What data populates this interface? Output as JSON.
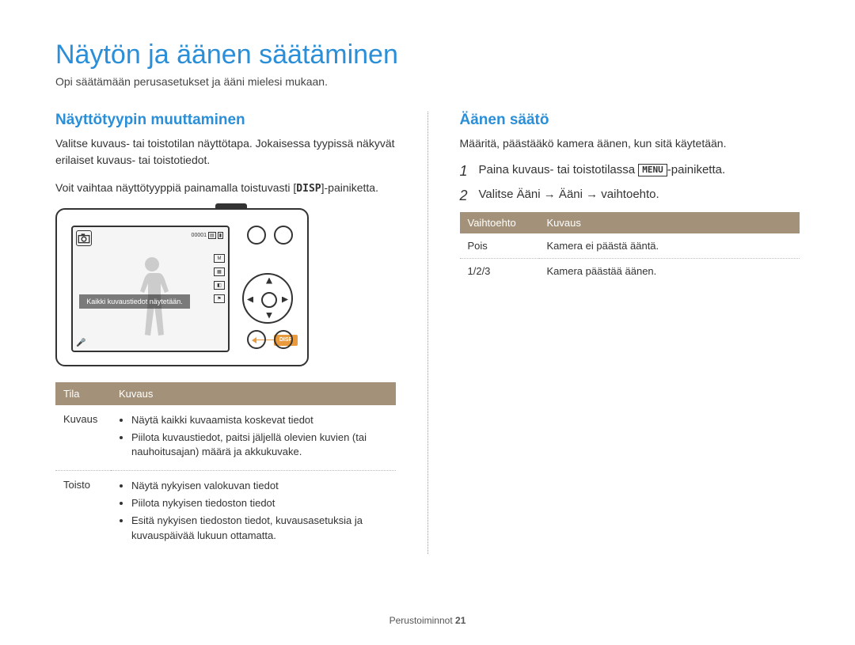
{
  "title": "Näytön ja äänen säätäminen",
  "subtitle": "Opi säätämään perusasetukset ja ääni mielesi mukaan.",
  "left": {
    "section_title": "Näyttötyypin muuttaminen",
    "p1": "Valitse kuvaus- tai toistotilan näyttötapa. Jokaisessa tyypissä näkyvät erilaiset kuvaus- tai toistotiedot.",
    "p2_prefix": "Voit vaihtaa näyttötyyppiä painamalla toistuvasti [",
    "p2_disp": "DISP",
    "p2_suffix": "]-painiketta.",
    "lcd_caption": "Kaikki kuvaustiedot näytetään.",
    "lcd_counter": "00001",
    "disp_indicator": "DISP",
    "table": {
      "headers": [
        "Tila",
        "Kuvaus"
      ],
      "rows": [
        {
          "mode": "Kuvaus",
          "items": [
            "Näytä kaikki kuvaamista koskevat tiedot",
            "Piilota kuvaustiedot, paitsi jäljellä olevien kuvien (tai nauhoitusajan) määrä ja akkukuvake."
          ]
        },
        {
          "mode": "Toisto",
          "items": [
            "Näytä nykyisen valokuvan tiedot",
            "Piilota nykyisen tiedoston tiedot",
            "Esitä nykyisen tiedoston tiedot, kuvausasetuksia ja kuvauspäivää lukuun ottamatta."
          ]
        }
      ]
    }
  },
  "right": {
    "section_title": "Äänen säätö",
    "p1": "Määritä, päästääkö kamera äänen, kun sitä käytetään.",
    "step1_prefix": "Paina kuvaus- tai toistotilassa ",
    "step1_menu": "MENU",
    "step1_suffix": "-painiketta.",
    "step2": "Valitse Ääni → Ääni → vaihtoehto.",
    "table": {
      "headers": [
        "Vaihtoehto",
        "Kuvaus"
      ],
      "rows": [
        {
          "opt": "Pois",
          "desc": "Kamera ei päästä ääntä."
        },
        {
          "opt": "1/2/3",
          "desc": "Kamera päästää äänen."
        }
      ]
    }
  },
  "footer": {
    "label": "Perustoiminnot",
    "page": "21"
  }
}
